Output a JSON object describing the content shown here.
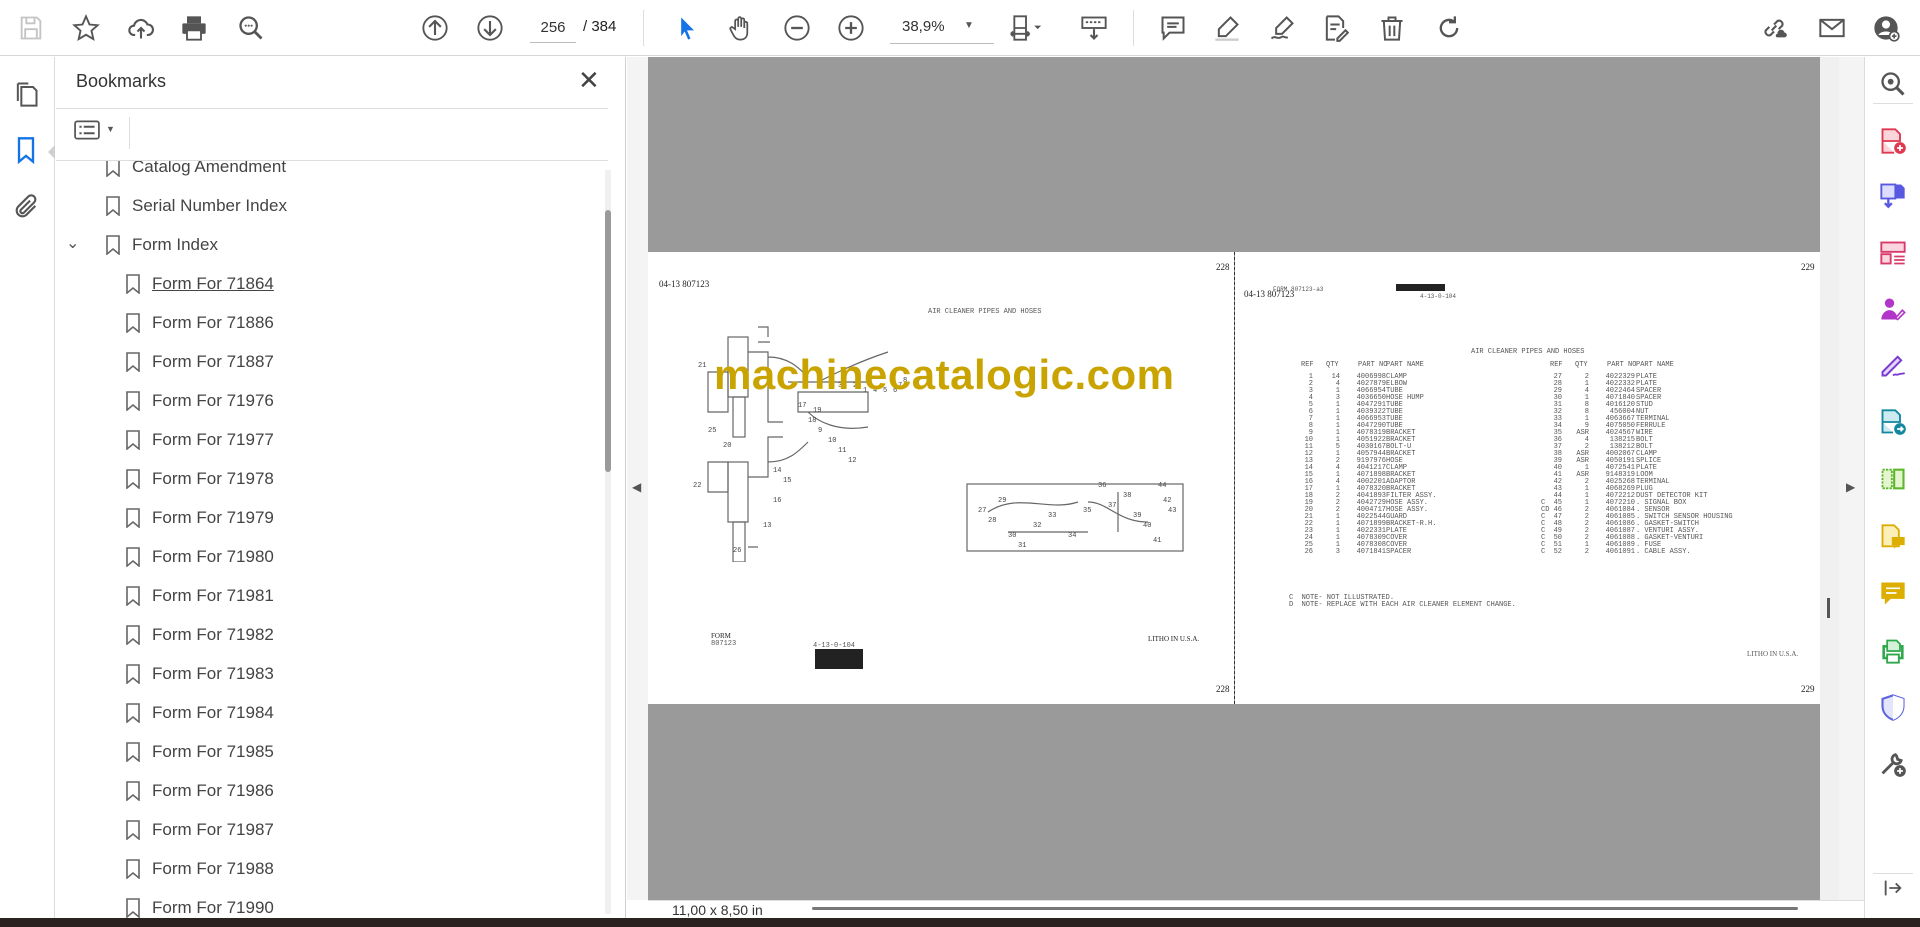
{
  "toolbar": {
    "page_current": "256",
    "page_total": "/ 384",
    "zoom": "38,9%"
  },
  "bookmarks": {
    "title": "Bookmarks",
    "items": [
      {
        "label": "Catalog Amendment"
      },
      {
        "label": "Serial Number Index"
      },
      {
        "label": "Form Index"
      },
      {
        "label": "Form For 71864"
      },
      {
        "label": "Form For 71886"
      },
      {
        "label": "Form For 71887"
      },
      {
        "label": "Form For 71976"
      },
      {
        "label": "Form For 71977"
      },
      {
        "label": "Form For 71978"
      },
      {
        "label": "Form For 71979"
      },
      {
        "label": "Form For 71980"
      },
      {
        "label": "Form For 71981"
      },
      {
        "label": "Form For 71982"
      },
      {
        "label": "Form For 71983"
      },
      {
        "label": "Form For 71984"
      },
      {
        "label": "Form For 71985"
      },
      {
        "label": "Form For 71986"
      },
      {
        "label": "Form For 71987"
      },
      {
        "label": "Form For 71988"
      },
      {
        "label": "Form For 71990"
      }
    ]
  },
  "document": {
    "watermark": "machinecatalogic.com",
    "left_page": {
      "header_code": "04-13  807123",
      "page_number": "228",
      "title": "AIR CLEANER PIPES AND HOSES",
      "form_label": "FORM",
      "form_number": "807123",
      "stamp": "4-13-0-104",
      "litho": "LITHO IN U.S.A.",
      "diagram_labels": [
        "21",
        "22",
        "26",
        "25",
        "20",
        "18",
        "19",
        "17",
        "3",
        "2",
        "1",
        "4",
        "5",
        "6",
        "7",
        "8",
        "9",
        "10",
        "11",
        "12",
        "13",
        "14",
        "15",
        "16",
        "27",
        "28",
        "29",
        "30",
        "31",
        "32",
        "33",
        "34",
        "35",
        "36",
        "37",
        "38",
        "39",
        "40",
        "41",
        "42",
        "43",
        "44"
      ]
    },
    "right_page": {
      "header_code": "04-13  807123",
      "form_label": "FORM 807123-a3",
      "stamp": "4-13-0-104",
      "page_number": "229",
      "title": "AIR CLEANER PIPES AND HOSES",
      "columns": [
        "REF",
        "QTY",
        "PART NO",
        "PART NAME"
      ],
      "left_rows": [
        [
          "",
          "1",
          "14",
          "4006998",
          "CLAMP"
        ],
        [
          "",
          "2",
          "4",
          "4027879",
          "ELBOW"
        ],
        [
          "",
          "3",
          "1",
          "4066954",
          "TUBE"
        ],
        [
          "",
          "4",
          "3",
          "4036650",
          "HOSE HUMP"
        ],
        [
          "",
          "5",
          "1",
          "4047291",
          "TUBE"
        ],
        [
          "",
          "6",
          "1",
          "4039322",
          "TUBE"
        ],
        [
          "",
          "7",
          "1",
          "4066953",
          "TUBE"
        ],
        [
          "",
          "8",
          "1",
          "4047290",
          "TUBE"
        ],
        [
          "",
          "9",
          "1",
          "4078319",
          "BRACKET"
        ],
        [
          "",
          "10",
          "1",
          "4051922",
          "BRACKET"
        ],
        [
          "",
          "11",
          "5",
          "4030167",
          "BOLT-U"
        ],
        [
          "",
          "12",
          "1",
          "4057944",
          "BRACKET"
        ],
        [
          "",
          "13",
          "2",
          "9197976",
          "HOSE"
        ],
        [
          "",
          "14",
          "4",
          "4041217",
          "CLAMP"
        ],
        [
          "",
          "15",
          "1",
          "4071898",
          "BRACKET"
        ],
        [
          "",
          "16",
          "4",
          "4002201",
          "ADAPTOR"
        ],
        [
          "",
          "17",
          "1",
          "4078320",
          "BRACKET"
        ],
        [
          "",
          "18",
          "2",
          "4041893",
          "FILTER ASSY."
        ],
        [
          "",
          "19",
          "2",
          "4042729",
          "HOSE ASSY."
        ],
        [
          "",
          "20",
          "2",
          "4004717",
          "HOSE ASSY."
        ],
        [
          "",
          "21",
          "1",
          "4022544",
          "GUARD"
        ],
        [
          "",
          "22",
          "1",
          "4071899",
          "BRACKET-R.H."
        ],
        [
          "",
          "23",
          "1",
          "4022331",
          "PLATE"
        ],
        [
          "",
          "24",
          "1",
          "4078309",
          "COVER"
        ],
        [
          "",
          "25",
          "1",
          "4078308",
          "COVER"
        ],
        [
          "",
          "26",
          "3",
          "4071841",
          "SPACER"
        ]
      ],
      "right_rows": [
        [
          "",
          "27",
          "2",
          "4022329",
          "PLATE"
        ],
        [
          "",
          "28",
          "1",
          "4022332",
          "PLATE"
        ],
        [
          "",
          "29",
          "4",
          "4022464",
          "SPACER"
        ],
        [
          "",
          "30",
          "1",
          "4071840",
          "SPACER"
        ],
        [
          "",
          "31",
          "8",
          "4016120",
          "STUD"
        ],
        [
          "",
          "32",
          "8",
          "456004",
          "NUT"
        ],
        [
          "",
          "33",
          "1",
          "4063667",
          "TERMINAL"
        ],
        [
          "",
          "34",
          "9",
          "4075050",
          "FERRULE"
        ],
        [
          "",
          "35",
          "ASR",
          "4024567",
          "WIRE"
        ],
        [
          "",
          "36",
          "4",
          "138215",
          "BOLT"
        ],
        [
          "",
          "37",
          "2",
          "138212",
          "BOLT"
        ],
        [
          "",
          "38",
          "ASR",
          "4002067",
          "CLAMP"
        ],
        [
          "",
          "39",
          "ASR",
          "4050191",
          "SPLICE"
        ],
        [
          "",
          "40",
          "1",
          "4072541",
          "PLATE"
        ],
        [
          "",
          "41",
          "ASR",
          "9148319",
          "LOOM"
        ],
        [
          "",
          "42",
          "2",
          "4025268",
          "TERMINAL"
        ],
        [
          "",
          "43",
          "1",
          "4068269",
          "PLUG"
        ],
        [
          "",
          "44",
          "1",
          "4072212",
          "DUST DETECTOR KIT"
        ],
        [
          "C",
          "45",
          "1",
          "4072210",
          ". SIGNAL BOX"
        ],
        [
          "CD",
          "46",
          "2",
          "4061084",
          ". SENSOR"
        ],
        [
          "C",
          "47",
          "2",
          "4061085",
          ". SWITCH SENSOR HOUSING"
        ],
        [
          "C",
          "48",
          "2",
          "4061086",
          ". GASKET-SWITCH"
        ],
        [
          "C",
          "49",
          "2",
          "4061087",
          ". VENTURI ASSY."
        ],
        [
          "C",
          "50",
          "2",
          "4061088",
          ". GASKET-VENTURI"
        ],
        [
          "C",
          "51",
          "1",
          "4061089",
          ". FUSE"
        ],
        [
          "C",
          "52",
          "2",
          "4061091",
          ". CABLE ASSY."
        ]
      ],
      "notes": [
        "C  NOTE- NOT ILLUSTRATED.",
        "D  NOTE- REPLACE WITH EACH AIR CLEANER ELEMENT CHANGE."
      ],
      "litho": "LITHO IN U.S.A."
    }
  },
  "status": {
    "page_size": "11,00 x 8,50 in"
  },
  "colors": {
    "accent": "#1473e6",
    "watermark": "#c9a400",
    "doc_bg": "#9a9a9a"
  }
}
